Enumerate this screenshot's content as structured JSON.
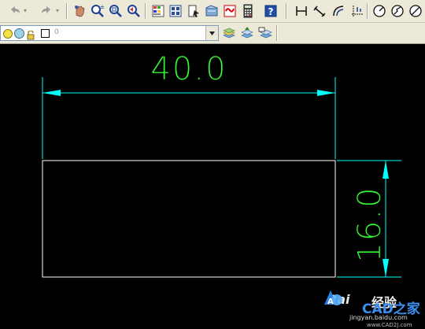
{
  "toolbar_top": {
    "icons": [
      "undo-icon",
      "undo-dropdown-icon",
      "redo-icon",
      "redo-dropdown-icon",
      "pan-icon",
      "zoom-realtime-icon",
      "zoom-window-icon",
      "zoom-previous-icon",
      "properties-icon",
      "design-center-icon",
      "tool-palettes-icon",
      "sheet-set-icon",
      "markup-icon",
      "calculator-icon",
      "help-icon",
      "linear-dimension-icon",
      "aligned-dimension-icon",
      "arc-length-icon",
      "ordinate-dimension-icon",
      "radius-dimension-icon",
      "jogged-dimension-icon",
      "diameter-dimension-icon"
    ]
  },
  "layer_bar": {
    "current_layer": "0",
    "icons": [
      "layer-on-icon",
      "layer-freeze-icon",
      "layer-lock-icon",
      "layer-color-icon",
      "layer-manager-icon",
      "make-current-layer-icon",
      "layer-previous-icon"
    ]
  },
  "drawing": {
    "horizontal_dimension": "40.0",
    "vertical_dimension": "16.0",
    "colors": {
      "background": "#000000",
      "geometry": "#ffffff",
      "dimension_line": "#00ffff",
      "dimension_text": "#33ff33"
    }
  },
  "watermark": {
    "brand": "Bai",
    "jingyan": "经验",
    "cad_text": "CAD之家",
    "url_baidu": "jingyan.baidu.com",
    "url_cad": "www.CAD2J.com"
  }
}
